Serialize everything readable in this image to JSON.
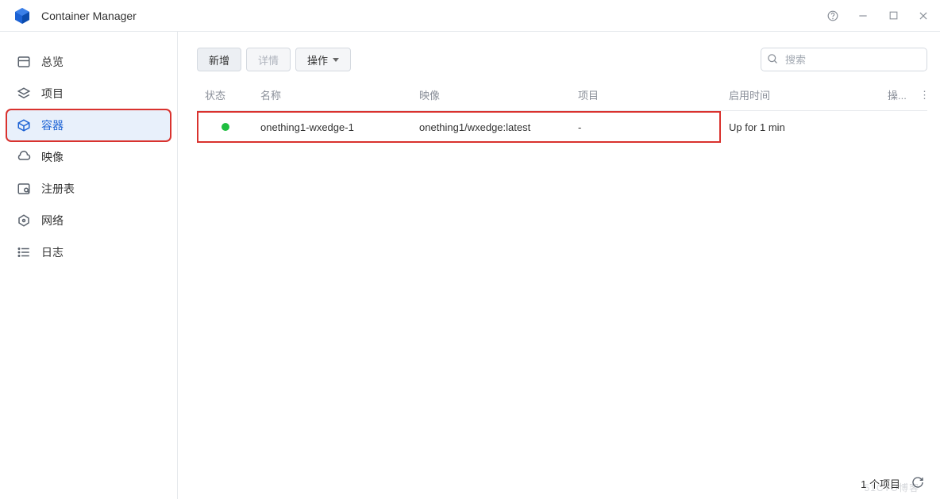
{
  "app": {
    "title": "Container Manager"
  },
  "window_controls": {
    "help": "?",
    "min": "−",
    "max": "☐",
    "close": "×"
  },
  "sidebar": {
    "items": [
      {
        "label": "总览"
      },
      {
        "label": "项目"
      },
      {
        "label": "容器"
      },
      {
        "label": "映像"
      },
      {
        "label": "注册表"
      },
      {
        "label": "网络"
      },
      {
        "label": "日志"
      }
    ]
  },
  "toolbar": {
    "create_label": "新增",
    "details_label": "详情",
    "action_label": "操作"
  },
  "search": {
    "placeholder": "搜索"
  },
  "table": {
    "columns": {
      "status": "状态",
      "name": "名称",
      "image": "映像",
      "project": "项目",
      "uptime": "启用时间",
      "action": "操..."
    },
    "rows": [
      {
        "name": "onething1-wxedge-1",
        "image": "onething1/wxedge:latest",
        "project": "-",
        "uptime": "Up for 1 min",
        "status": "running"
      }
    ]
  },
  "footer": {
    "count_text": "1 个项目"
  },
  "watermark": "51CTO博客"
}
